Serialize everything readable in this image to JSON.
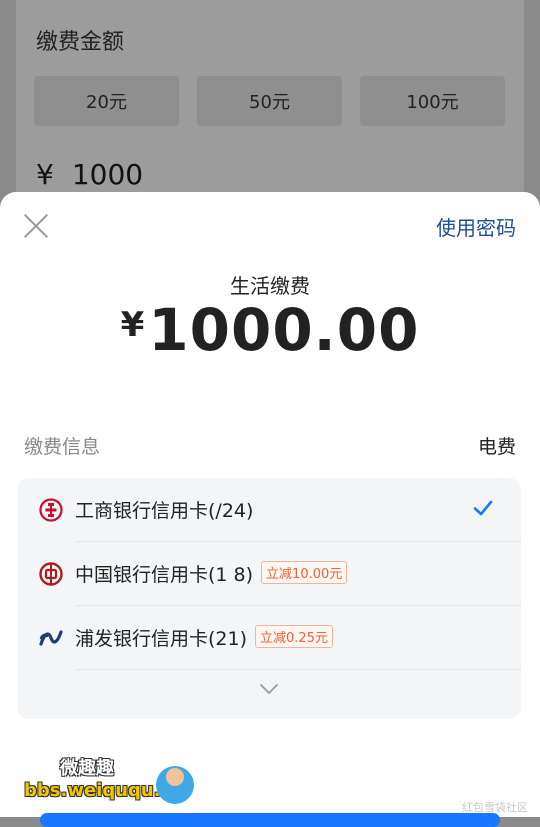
{
  "background": {
    "title": "缴费金额",
    "amount_options": [
      "20元",
      "50元",
      "100元"
    ],
    "currency_symbol": "¥",
    "amount_value": "1000"
  },
  "sheet": {
    "close_icon": "close-icon",
    "use_password": "使用密码",
    "service_name": "生活缴费",
    "currency_symbol": "¥",
    "amount": "1000.00",
    "info_label": "缴费信息",
    "info_value": "电费",
    "cards": [
      {
        "name": "工商银行信用卡(​/​2​4)",
        "promo": "",
        "selected": true,
        "icon": "icbc-logo-icon"
      },
      {
        "name": "中国银行信用卡(​1​ 8)",
        "promo": "立减10.00元",
        "selected": false,
        "icon": "boc-logo-icon"
      },
      {
        "name": "浦发银行信用卡(​2​1)",
        "promo": "立减0.25元",
        "selected": false,
        "icon": "spdb-logo-icon"
      }
    ],
    "expand_icon": "chevron-down-icon"
  },
  "watermark": {
    "line1": "微趣趣",
    "line2": "bbs.weiququ.cn"
  },
  "footer_note": "红包雪袋社区",
  "colors": {
    "accent_blue": "#1f4e99",
    "check_blue": "#1677ff",
    "promo_orange": "#e8643a"
  }
}
